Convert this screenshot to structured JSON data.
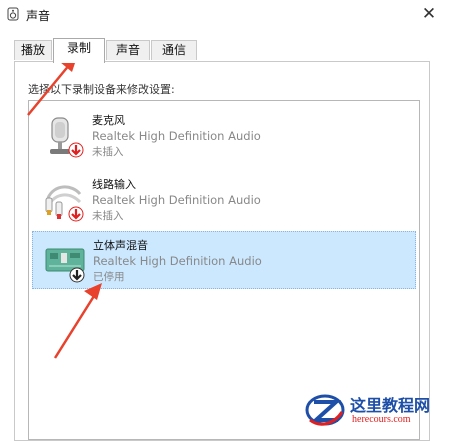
{
  "window": {
    "title": "声音",
    "close_glyph": "✕"
  },
  "tabs": [
    {
      "label": "播放",
      "active": false
    },
    {
      "label": "录制",
      "active": true
    },
    {
      "label": "声音",
      "active": false
    },
    {
      "label": "通信",
      "active": false
    }
  ],
  "instruction": "选择以下录制设备来修改设置:",
  "devices": [
    {
      "name": "麦克风",
      "driver": "Realtek High Definition Audio",
      "status": "未插入",
      "icon": "microphone-icon",
      "badge": "red-down-arrow-badge",
      "selected": false
    },
    {
      "name": "线路输入",
      "driver": "Realtek High Definition Audio",
      "status": "未插入",
      "icon": "line-in-cable-icon",
      "badge": "red-down-arrow-badge",
      "selected": false
    },
    {
      "name": "立体声混音",
      "driver": "Realtek High Definition Audio",
      "status": "已停用",
      "icon": "circuit-board-icon",
      "badge": "black-down-arrow-badge",
      "selected": true
    }
  ],
  "annotations": {
    "arrow_color": "#e8412c"
  },
  "watermark": {
    "title": "这里教程网",
    "url": "herecours.com"
  },
  "colors": {
    "selection": "#cce8ff",
    "accent_red": "#e02020",
    "watermark_blue": "#1e4fa8"
  }
}
